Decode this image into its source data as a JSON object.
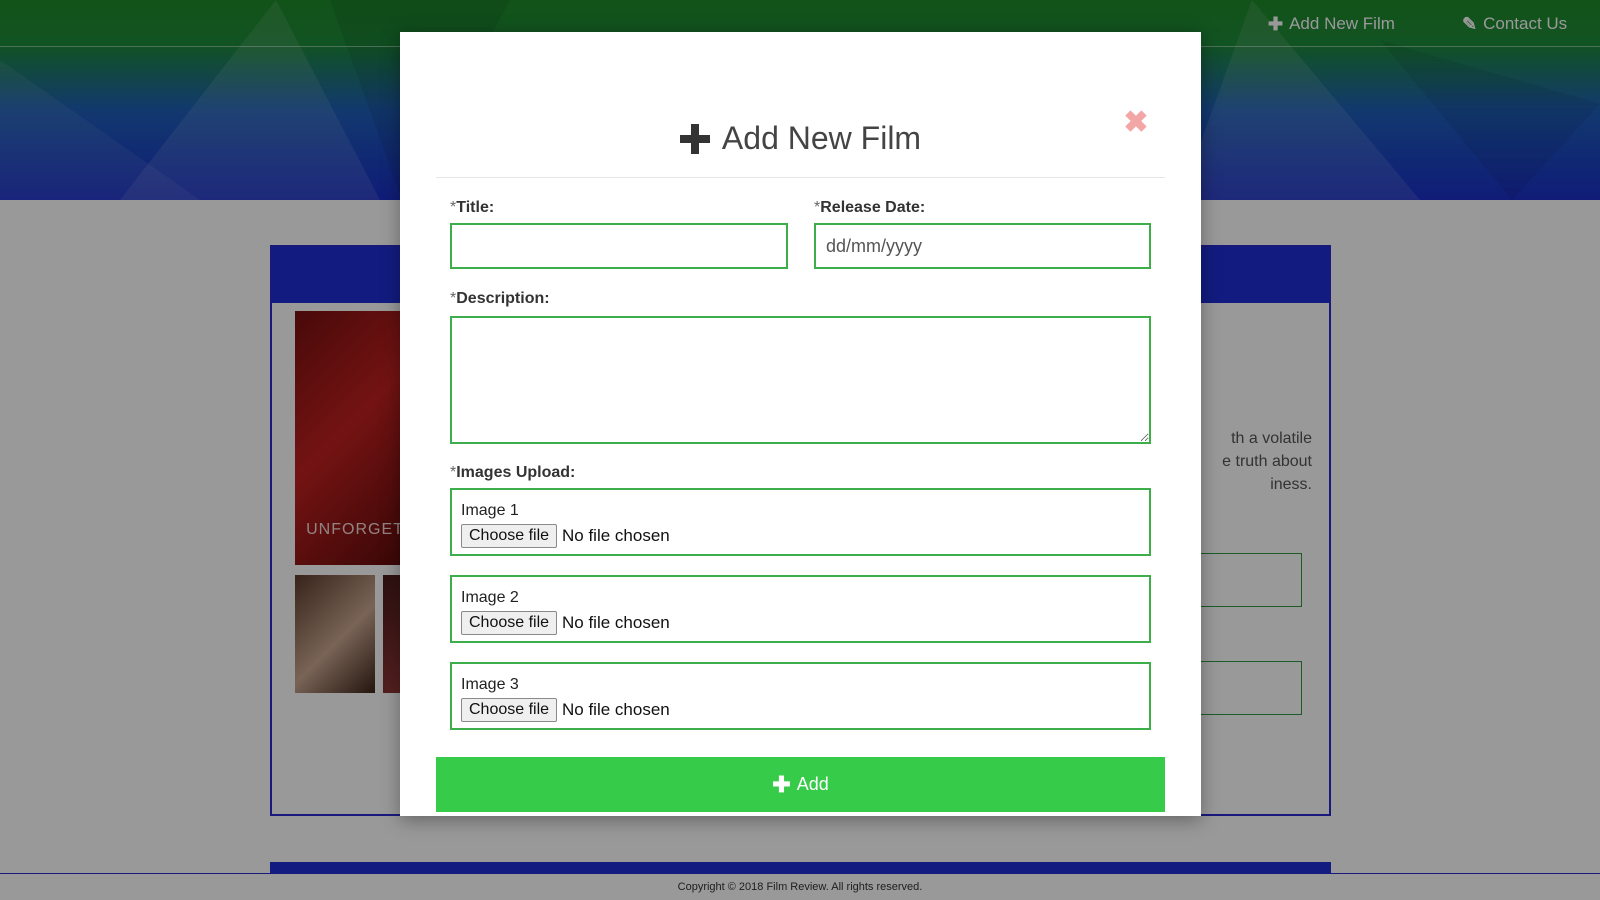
{
  "nav": {
    "add_new_film": "Add New Film",
    "contact_us": "Contact Us"
  },
  "background": {
    "poster_text": "UNFORGET",
    "blurb_lines": [
      "th a volatile",
      "e truth about",
      "iness."
    ],
    "footer": "Copyright © 2018 Film Review. All rights reserved."
  },
  "modal": {
    "title": "Add New Film",
    "close_symbol": "✖",
    "fields": {
      "title_label": "Title:",
      "release_date_label": "Release Date:",
      "release_date_placeholder": "dd/mm/yyyy",
      "description_label": "Description:",
      "images_label": "Images Upload:",
      "required_marker": "*"
    },
    "images": [
      {
        "label": "Image 1",
        "button": "Choose file",
        "status": "No file chosen"
      },
      {
        "label": "Image 2",
        "button": "Choose file",
        "status": "No file chosen"
      },
      {
        "label": "Image 3",
        "button": "Choose file",
        "status": "No file chosen"
      }
    ],
    "submit_label": "Add"
  },
  "colors": {
    "accent_green": "#36cb48",
    "field_border": "#3cae4a",
    "brand_blue": "#1f2fd6",
    "close_pink": "#f3a6a6"
  },
  "icons": {
    "add": "plus-icon",
    "contact": "edit-icon",
    "close": "close-icon"
  }
}
